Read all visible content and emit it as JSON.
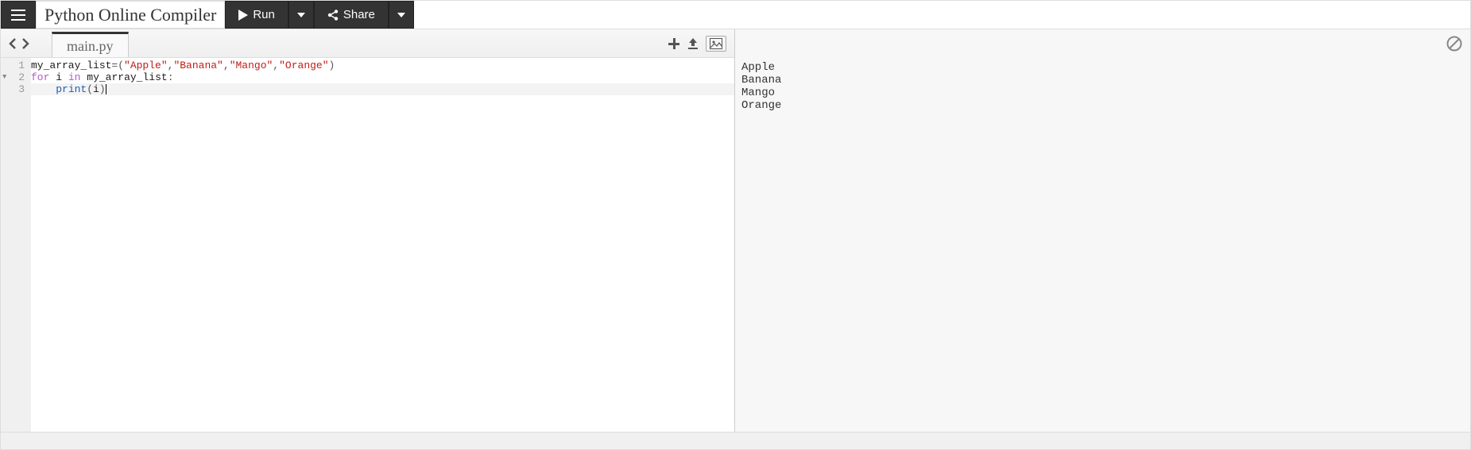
{
  "header": {
    "title": "Python Online Compiler",
    "run_label": "Run",
    "share_label": "Share"
  },
  "editor": {
    "tab_name": "main.py",
    "line_numbers": [
      "1",
      "2",
      "3"
    ],
    "fold_marker_line": 2,
    "active_line": 3,
    "code": {
      "line1": {
        "var": "my_array_list",
        "op": "=(",
        "s1": "\"Apple\"",
        "c1": ",",
        "s2": "\"Banana\"",
        "c2": ",",
        "s3": "\"Mango\"",
        "c3": ",",
        "s4": "\"Orange\"",
        "close": ")"
      },
      "line2": {
        "kw1": "for",
        "sp1": " ",
        "var1": "i",
        "sp2": " ",
        "kw2": "in",
        "sp3": " ",
        "var2": "my_array_list",
        "colon": ":"
      },
      "line3": {
        "indent": "    ",
        "fn": "print",
        "open": "(",
        "arg": "i",
        "close": ")"
      }
    }
  },
  "output": {
    "lines": [
      "Apple",
      "Banana",
      "Mango",
      "Orange"
    ]
  }
}
